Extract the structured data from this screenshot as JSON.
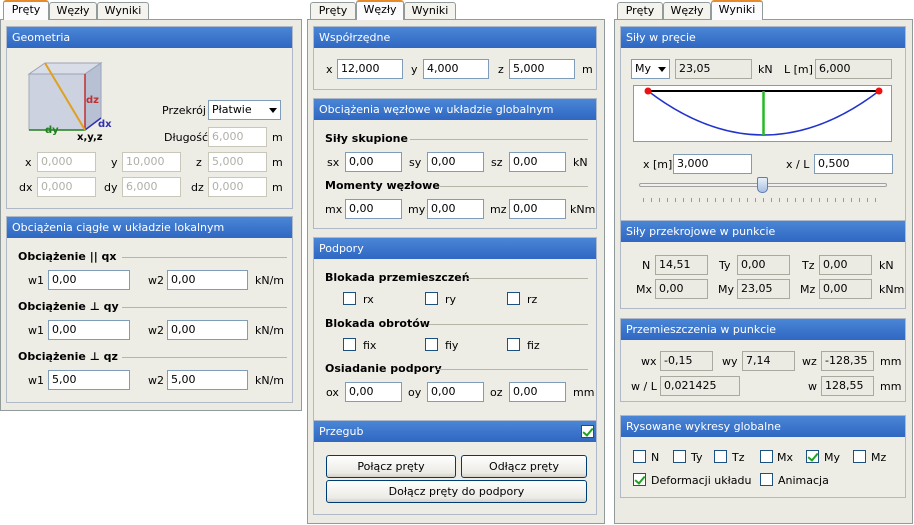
{
  "tabs": [
    "Pręty",
    "Węzły",
    "Wyniki"
  ],
  "panel1": {
    "geometry": {
      "title": "Geometria",
      "cube_labels": {
        "dz": "dz",
        "dx": "dx",
        "dy": "dy",
        "xyz": "x,y,z"
      },
      "section_label": "Przekrój",
      "section_value": "Płatwie",
      "length_label": "Długość",
      "length_value": "6,000",
      "length_unit": "m",
      "x_label": "x",
      "x_value": "0,000",
      "y_label": "y",
      "y_value": "10,000",
      "z_label": "z",
      "z_value": "5,000",
      "xyz_unit": "m",
      "dx_label": "dx",
      "dx_value": "0,000",
      "dy_label": "dy",
      "dy_value": "6,000",
      "dz_label": "dz",
      "dz_value": "0,000",
      "dxyz_unit": "m"
    },
    "loads": {
      "title": "Obciążenia ciągłe w układzie lokalnym",
      "rows": [
        {
          "heading": "Obciążenie || qx",
          "w1_label": "w1",
          "w1": "0,00",
          "w2_label": "w2",
          "w2": "0,00",
          "unit": "kN/m"
        },
        {
          "heading": "Obciążenie ⊥ qy",
          "w1_label": "w1",
          "w1": "0,00",
          "w2_label": "w2",
          "w2": "0,00",
          "unit": "kN/m"
        },
        {
          "heading": "Obciążenie ⊥ qz",
          "w1_label": "w1",
          "w1": "5,00",
          "w2_label": "w2",
          "w2": "5,00",
          "unit": "kN/m"
        }
      ]
    }
  },
  "panel2": {
    "coords": {
      "title": "Współrzędne",
      "x_label": "x",
      "x": "12,000",
      "y_label": "y",
      "y": "4,000",
      "z_label": "z",
      "z": "5,000",
      "unit": "m"
    },
    "nodal": {
      "title": "Obciążenia węzłowe w układzie globalnym",
      "forces_heading": "Siły skupione",
      "sx_label": "sx",
      "sx": "0,00",
      "sy_label": "sy",
      "sy": "0,00",
      "sz_label": "sz",
      "sz": "0,00",
      "forces_unit": "kN",
      "moments_heading": "Momenty węzłowe",
      "mx_label": "mx",
      "mx": "0,00",
      "my_label": "my",
      "my": "0,00",
      "mz_label": "mz",
      "mz": "0,00",
      "moments_unit": "kNm"
    },
    "supports": {
      "title": "Podpory",
      "disp_heading": "Blokada przemieszczeń",
      "rx": "rx",
      "ry": "ry",
      "rz": "rz",
      "rot_heading": "Blokada obrotów",
      "fix": "fix",
      "fiy": "fiy",
      "fiz": "fiz",
      "settle_heading": "Osiadanie podpory",
      "ox_label": "ox",
      "ox": "0,00",
      "oy_label": "oy",
      "oy": "0,00",
      "oz_label": "oz",
      "oz": "0,00",
      "unit": "mm"
    },
    "hinge": {
      "title": "Przegub",
      "checked": true,
      "connect": "Połącz pręty",
      "disconnect": "Odłącz pręty",
      "attach": "Dołącz pręty do podpory"
    }
  },
  "panel3": {
    "forces": {
      "title": "Siły w pręcie",
      "component": "My",
      "value": "23,05",
      "value_unit": "kN",
      "L_label": "L [m]",
      "L": "6,000",
      "x_label": "x [m]",
      "x": "3,000",
      "xL_label": "x / L",
      "xL": "0,500",
      "slider_position": 0.5,
      "diagram_color": "#2233cc",
      "marker_color": "#22bb22"
    },
    "section": {
      "title": "Siły przekrojowe w punkcie",
      "N_label": "N",
      "N": "14,51",
      "Ty_label": "Ty",
      "Ty": "0,00",
      "Tz_label": "Tz",
      "Tz": "0,00",
      "force_unit": "kN",
      "Mx_label": "Mx",
      "Mx": "0,00",
      "My_label": "My",
      "My": "23,05",
      "Mz_label": "Mz",
      "Mz": "0,00",
      "moment_unit": "kNm"
    },
    "disp": {
      "title": "Przemieszczenia w punkcie",
      "wx_label": "wx",
      "wx": "-0,15",
      "wy_label": "wy",
      "wy": "7,14",
      "wz_label": "wz",
      "wz": "-128,35",
      "unit": "mm",
      "wL_label": "w / L",
      "wL": "0,021425",
      "w_label": "w",
      "w": "128,55",
      "w_unit": "mm"
    },
    "plots": {
      "title": "Rysowane wykresy globalne",
      "N": "N",
      "Ty": "Ty",
      "Tz": "Tz",
      "Mx": "Mx",
      "My": "My",
      "Mz": "Mz",
      "deform": "Deformacji układu",
      "anim": "Animacja"
    }
  }
}
